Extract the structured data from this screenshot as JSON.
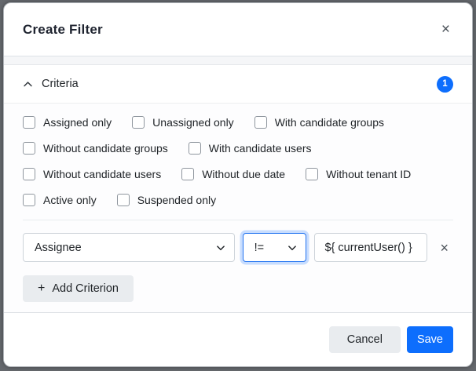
{
  "modal": {
    "title": "Create Filter",
    "close_icon": "×"
  },
  "criteria_section": {
    "label": "Criteria",
    "badge_count": "1",
    "collapse_icon": "chevron-up-icon"
  },
  "checkboxes": {
    "rows": [
      [
        "Assigned only",
        "Unassigned only",
        "With candidate groups"
      ],
      [
        "Without candidate groups",
        "With candidate users"
      ],
      [
        "Without candidate users",
        "Without due date",
        "Without tenant ID"
      ],
      [
        "Active only",
        "Suspended only"
      ]
    ],
    "all_unchecked": true
  },
  "criterion_row": {
    "key_select": {
      "value": "Assignee",
      "icon": "chevron-down-icon"
    },
    "operator_select": {
      "value": "!=",
      "icon": "chevron-down-icon",
      "focused": true
    },
    "value_input": {
      "value": "${ currentUser() }"
    },
    "remove_icon": "×"
  },
  "add_criterion": {
    "icon": "+",
    "label": "Add Criterion"
  },
  "footer": {
    "cancel_label": "Cancel",
    "save_label": "Save"
  },
  "colors": {
    "primary": "#0d6efd",
    "badge": "#0d6efd",
    "focus_ring": "rgba(13,110,253,0.22)",
    "secondary_button": "#e9ecef",
    "border": "#ced4da",
    "backdrop": "#65686d"
  }
}
